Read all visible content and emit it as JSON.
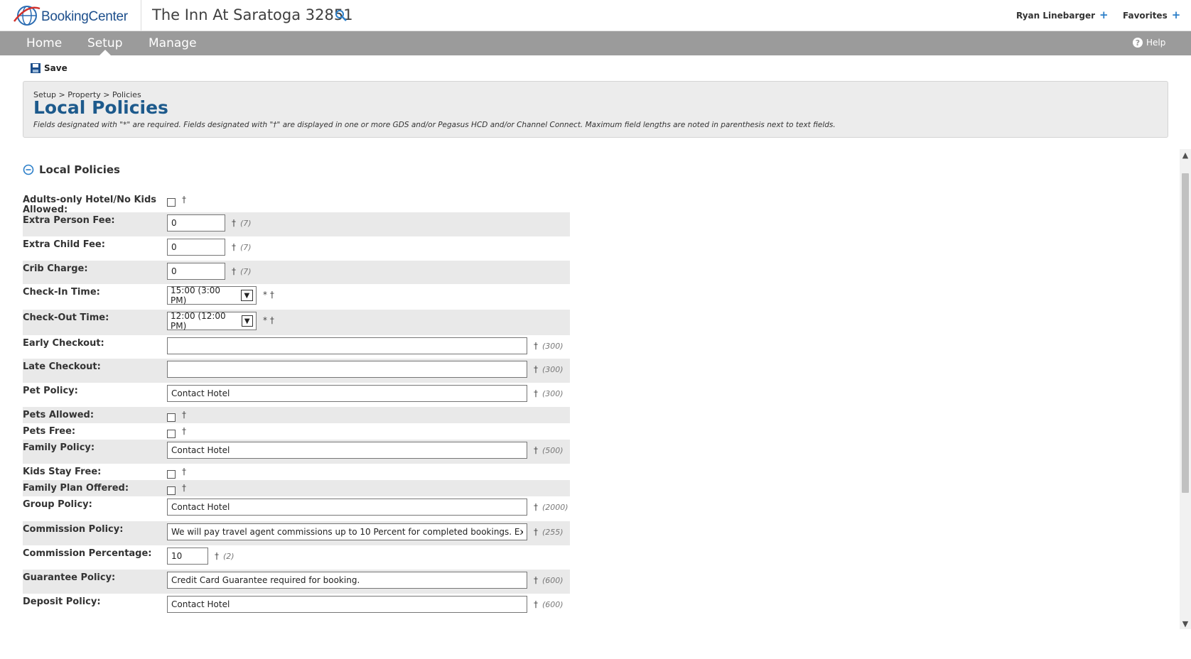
{
  "header": {
    "logo_text": "BookingCenter",
    "property_title": "The Inn At Saratoga 32851",
    "user_name": "Ryan Linebarger",
    "favorites": "Favorites",
    "plus": "+"
  },
  "nav": {
    "items": [
      {
        "label": "Home"
      },
      {
        "label": "Setup",
        "active": true
      },
      {
        "label": "Manage"
      }
    ],
    "help": "Help"
  },
  "toolbar": {
    "save_label": "Save"
  },
  "page": {
    "breadcrumb": "Setup > Property > Policies",
    "title": "Local Policies",
    "instructions": "Fields designated with \"*\" are required. Fields designated with \"†\" are displayed in one or more GDS and/or Pegasus HCD and/or Channel Connect. Maximum field lengths are noted in parenthesis next to text fields."
  },
  "section": {
    "title": "Local Policies"
  },
  "fields": [
    {
      "label": "Adults-only Hotel/No Kids Allowed:",
      "type": "checkbox",
      "checked": false,
      "marks": "†",
      "maxlen": ""
    },
    {
      "label": "Extra Person Fee:",
      "type": "text",
      "value": "0",
      "marks": "†",
      "maxlen": "(7)"
    },
    {
      "label": "Extra Child Fee:",
      "type": "text",
      "value": "0",
      "marks": "†",
      "maxlen": "(7)"
    },
    {
      "label": "Crib Charge:",
      "type": "text",
      "value": "0",
      "marks": "†",
      "maxlen": "(7)"
    },
    {
      "label": "Check-In Time:",
      "type": "select",
      "value": "15:00 (3:00 PM)",
      "marks": "* †",
      "maxlen": ""
    },
    {
      "label": "Check-Out Time:",
      "type": "select",
      "value": "12:00 (12:00 PM)",
      "marks": "* †",
      "maxlen": ""
    },
    {
      "label": "Early Checkout:",
      "type": "text",
      "value": "",
      "marks": "†",
      "maxlen": "(300)"
    },
    {
      "label": "Late Checkout:",
      "type": "text",
      "value": "",
      "marks": "†",
      "maxlen": "(300)"
    },
    {
      "label": "Pet Policy:",
      "type": "text",
      "value": "Contact Hotel",
      "marks": "†",
      "maxlen": "(300)"
    },
    {
      "label": "Pets Allowed:",
      "type": "checkbox",
      "checked": false,
      "marks": "†",
      "maxlen": ""
    },
    {
      "label": "Pets Free:",
      "type": "checkbox",
      "checked": false,
      "marks": "†",
      "maxlen": ""
    },
    {
      "label": "Family Policy:",
      "type": "text",
      "value": "Contact Hotel",
      "marks": "†",
      "maxlen": "(500)"
    },
    {
      "label": "Kids Stay Free:",
      "type": "checkbox",
      "checked": false,
      "marks": "†",
      "maxlen": ""
    },
    {
      "label": "Family Plan Offered:",
      "type": "checkbox",
      "checked": false,
      "marks": "†",
      "maxlen": ""
    },
    {
      "label": "Group Policy:",
      "type": "text",
      "value": "Contact Hotel",
      "marks": "†",
      "maxlen": "(2000)"
    },
    {
      "label": "Commission Policy:",
      "type": "text",
      "value": "We will pay travel agent commissions up to 10 Percent for completed bookings. Exceptions may apply.",
      "marks": "†",
      "maxlen": "(255)"
    },
    {
      "label": "Commission Percentage:",
      "type": "text",
      "value": "10",
      "marks": "†",
      "maxlen": "(2)"
    },
    {
      "label": "Guarantee Policy:",
      "type": "text",
      "value": "Credit Card Guarantee required for booking.",
      "marks": "†",
      "maxlen": "(600)"
    },
    {
      "label": "Deposit Policy:",
      "type": "text",
      "value": "Contact Hotel",
      "marks": "†",
      "maxlen": "(600)"
    }
  ]
}
